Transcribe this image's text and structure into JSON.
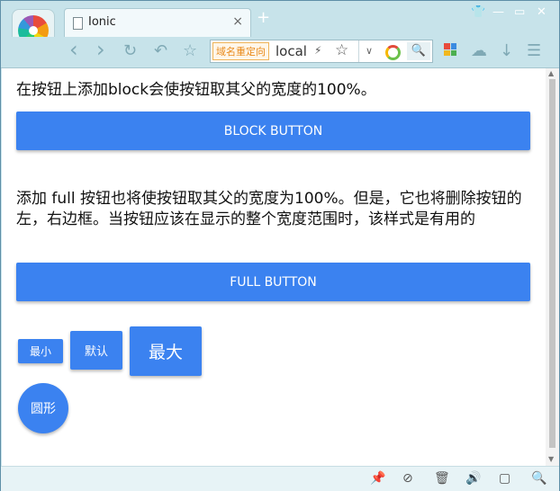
{
  "browser": {
    "tab": {
      "title": "Ionic",
      "close": "×"
    },
    "new_tab": "+",
    "window_controls": [
      "👕",
      "—",
      "▭",
      "✕"
    ],
    "toolbar": {
      "back": "‹",
      "forward": "›",
      "reload": "↻",
      "undo": "↶",
      "home": "☆",
      "redirect_badge": "域名重定向",
      "address": "local",
      "bolt": "⚡",
      "bookmark": "☆",
      "dropdown": "∨",
      "search": "🔍",
      "cloud": "☁",
      "download": "↓",
      "menu": "☰"
    },
    "status_icons": [
      "📌",
      "⊘",
      "🗑",
      "🔊",
      "▢",
      "🔍"
    ]
  },
  "page": {
    "block_desc": "在按钮上添加block会使按钮取其父的宽度的100%。",
    "block_button": "BLOCK BUTTON",
    "full_desc": "添加 full 按钮也将使按钮取其父的宽度为100%。但是，它也将删除按钮的左，右边框。当按钮应该在显示的整个宽度范围时，该样式是有用的",
    "full_button": "FULL BUTTON",
    "size_buttons": {
      "small": "最小",
      "default": "默认",
      "large": "最大"
    },
    "round_button": "圆形"
  }
}
